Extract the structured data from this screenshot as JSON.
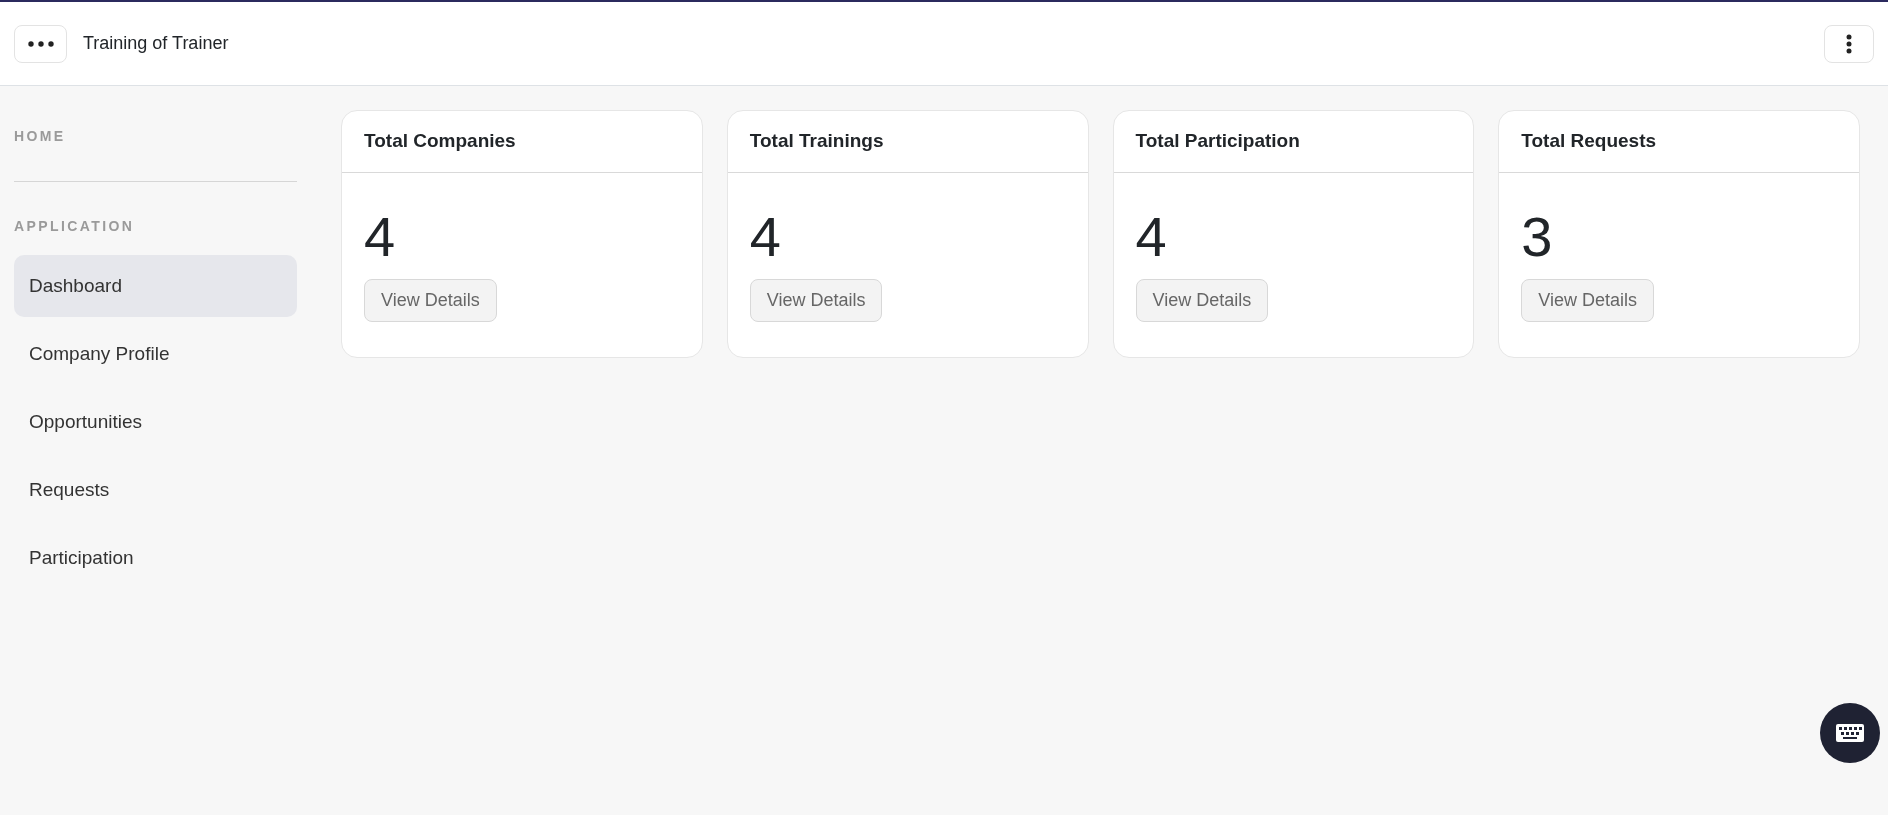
{
  "header": {
    "title": "Training of Trainer"
  },
  "sidebar": {
    "sections": [
      {
        "heading": "HOME"
      },
      {
        "heading": "APPLICATION",
        "items": [
          {
            "label": "Dashboard",
            "selected": true
          },
          {
            "label": "Company Profile",
            "selected": false
          },
          {
            "label": "Opportunities",
            "selected": false
          },
          {
            "label": "Requests",
            "selected": false
          },
          {
            "label": "Participation",
            "selected": false
          }
        ]
      }
    ]
  },
  "cards": [
    {
      "title": "Total Companies",
      "value": "4",
      "button": "View Details"
    },
    {
      "title": "Total Trainings",
      "value": "4",
      "button": "View Details"
    },
    {
      "title": "Total Participation",
      "value": "4",
      "button": "View Details"
    },
    {
      "title": "Total Requests",
      "value": "3",
      "button": "View Details"
    }
  ]
}
